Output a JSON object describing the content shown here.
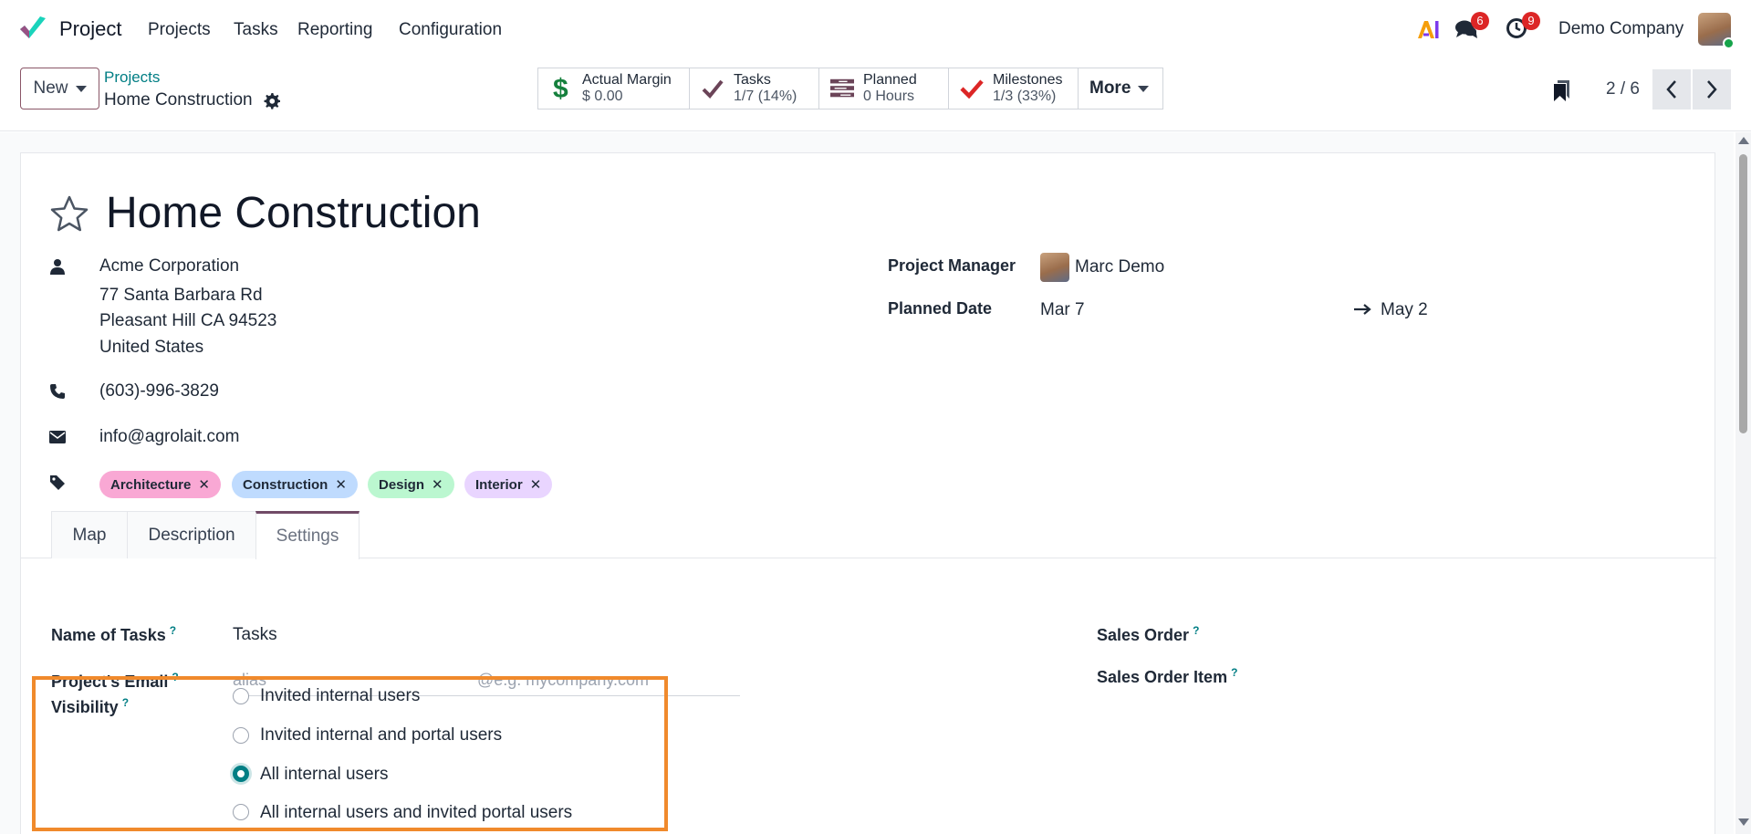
{
  "navbar": {
    "app_name": "Project",
    "menu": [
      "Projects",
      "Tasks",
      "Reporting",
      "Configuration"
    ],
    "messages_count": "6",
    "activities_count": "9",
    "company": "Demo Company",
    "icons": [
      "project-logo-icon",
      "ai-icon",
      "chat-icon",
      "clock-icon"
    ]
  },
  "control": {
    "new_label": "New",
    "breadcrumb_parent": "Projects",
    "breadcrumb_current": "Home Construction",
    "stats": [
      {
        "label": "Actual Margin",
        "value": "$ 0.00",
        "icon": "dollar-icon"
      },
      {
        "label": "Tasks",
        "value": "1/7 (14%)",
        "icon": "check-icon"
      },
      {
        "label": "Planned",
        "value": "0 Hours",
        "icon": "gantt-icon"
      },
      {
        "label": "Milestones",
        "value": "1/3 (33%)",
        "icon": "check-icon"
      }
    ],
    "more_label": "More",
    "pager": "2 / 6"
  },
  "form": {
    "title": "Home Construction",
    "customer": {
      "name": "Acme Corporation",
      "street": "77 Santa Barbara Rd",
      "city_line": "Pleasant Hill CA 94523",
      "country": "United States",
      "phone": "(603)-996-3829",
      "email": "info@agrolait.com"
    },
    "tags": [
      {
        "label": "Architecture",
        "color": "#f9a8d4"
      },
      {
        "label": "Construction",
        "color": "#bfdbfe"
      },
      {
        "label": "Design",
        "color": "#bbf7d0"
      },
      {
        "label": "Interior",
        "color": "#e9d5ff"
      }
    ],
    "project_manager_label": "Project Manager",
    "project_manager": "Marc Demo",
    "planned_date_label": "Planned Date",
    "planned_start": "Mar 7",
    "planned_end": "May 2",
    "tabs": [
      "Map",
      "Description",
      "Settings"
    ],
    "active_tab": "Settings",
    "settings": {
      "name_of_tasks_label": "Name of Tasks",
      "name_of_tasks": "Tasks",
      "email_label": "Project's Email",
      "alias_placeholder": "alias",
      "domain_placeholder": "@e.g. mycompany.com",
      "visibility_label": "Visibility",
      "visibility_options": [
        "Invited internal users",
        "Invited internal and portal users",
        "All internal users",
        "All internal users and invited portal users"
      ],
      "visibility_selected": "All internal users",
      "sales_order_label": "Sales Order",
      "sales_order_item_label": "Sales Order Item",
      "help_mark": "?"
    }
  },
  "colors": {
    "accent": "#017e84",
    "brand": "#714b67",
    "highlight": "#f08a2c",
    "badge": "#dc2626"
  }
}
